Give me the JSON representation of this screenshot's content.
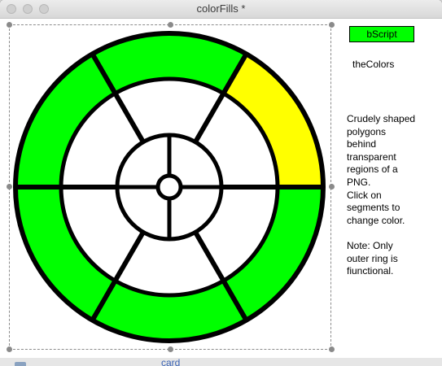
{
  "window": {
    "title": "colorFills *"
  },
  "button": {
    "label": "bScript"
  },
  "field": {
    "label": "theColors"
  },
  "description": "Crudely shaped\npolygons\nbehind\ntransparent\nregions of a\nPNG.\nClick on\nsegments to\nchange color.\n\nNote: Only\nouter ring is\nfiunctional.",
  "wheel": {
    "outer_ring_colors": [
      "#ffff00",
      "#00ff00",
      "#00ff00",
      "#00ff00",
      "#00ff00",
      "#00ff00"
    ],
    "middle_ring_color": "#ffffff",
    "inner_ring_color": "#ffffff",
    "stroke_color": "#000000"
  },
  "background_window": {
    "tab_label": "card"
  }
}
